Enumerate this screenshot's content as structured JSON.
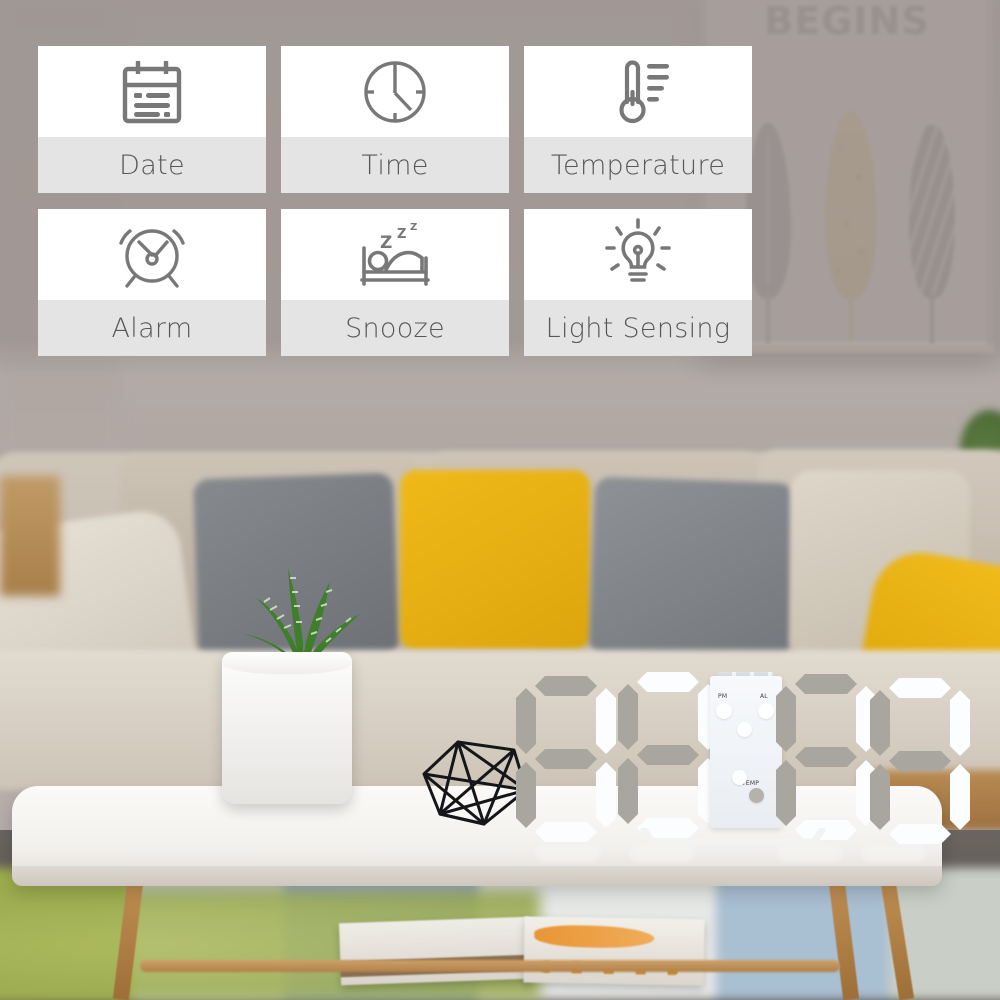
{
  "scene": {
    "type": "living-room-photo",
    "wall_art": {
      "title_text": "BEGINS",
      "motifs": [
        "feather-dark-blue",
        "feather-yellow",
        "feather-dark-gray"
      ]
    },
    "objects": [
      "sofa",
      "gray-pillow",
      "yellow-pillow",
      "white-pillow",
      "yellow-throw-blanket",
      "potted-zebra-plant",
      "wire-geometric-decor",
      "white-coffee-table",
      "stacked-boxes",
      "area-rug"
    ]
  },
  "colors": {
    "overlay_tint": "#a09794",
    "card_background": "#ffffff",
    "card_label_band": "#e4e4e4",
    "label_text": "#575757",
    "icon_stroke": "#787878",
    "pillow_yellow": "#e8b014",
    "pillow_gray": "#7d8186",
    "clock_body": "#fdfdfd",
    "clock_segment_off": "#a9a59f"
  },
  "features": {
    "cards": [
      {
        "id": "date",
        "label": "Date",
        "icon": "calendar-icon"
      },
      {
        "id": "time",
        "label": "Time",
        "icon": "clock-icon"
      },
      {
        "id": "temperature",
        "label": "Temperature",
        "icon": "thermometer-icon"
      },
      {
        "id": "alarm",
        "label": "Alarm",
        "icon": "alarm-clock-icon"
      },
      {
        "id": "snooze",
        "label": "Snooze",
        "icon": "sleeping-person-bed-icon"
      },
      {
        "id": "light_sensing",
        "label": "Light Sensing",
        "icon": "lightbulb-icon"
      }
    ]
  },
  "product": {
    "name": "3d-led-digital-wall-clock",
    "display": {
      "digits": [
        "8",
        "8",
        "8",
        "8"
      ],
      "display_text": "88:88",
      "indicators": [
        {
          "id": "pm",
          "label": "PM"
        },
        {
          "id": "al",
          "label": "AL"
        },
        {
          "id": "temp",
          "label": "TEMP"
        }
      ]
    }
  }
}
